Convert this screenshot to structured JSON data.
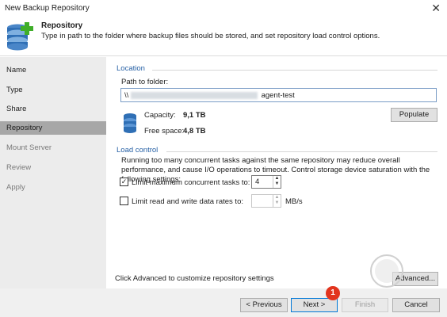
{
  "window": {
    "title": "New Backup Repository",
    "close_glyph": "✕"
  },
  "header": {
    "title": "Repository",
    "description": "Type in path to the folder where backup files should be stored, and set repository load control options.",
    "icon": "database-add-icon"
  },
  "sidebar": {
    "items": [
      {
        "label": "Name",
        "state": "normal"
      },
      {
        "label": "Type",
        "state": "normal"
      },
      {
        "label": "Share",
        "state": "normal"
      },
      {
        "label": "Repository",
        "state": "active"
      },
      {
        "label": "Mount Server",
        "state": "disabled"
      },
      {
        "label": "Review",
        "state": "disabled"
      },
      {
        "label": "Apply",
        "state": "disabled"
      }
    ]
  },
  "location": {
    "section_label": "Location",
    "path_label": "Path to folder:",
    "path_prefix": "\\\\",
    "path_suffix": "agent-test",
    "capacity_label": "Capacity:",
    "capacity_value": "9,1 TB",
    "free_label": "Free space:",
    "free_value": "4,8 TB",
    "populate_label": "Populate"
  },
  "load_control": {
    "section_label": "Load control",
    "description": "Running too many concurrent tasks against the same repository may reduce overall performance, and cause I/O operations to timeout. Control storage device saturation with the following settings:",
    "limit_tasks_label": "Limit maximum concurrent tasks to:",
    "limit_tasks_checked": true,
    "tasks_value": "4",
    "limit_rate_label": "Limit read and write data rates to:",
    "limit_rate_checked": false,
    "rate_value": "",
    "rate_unit": "MB/s"
  },
  "advanced": {
    "hint": "Click Advanced to customize repository settings",
    "button_label": "Advanced..."
  },
  "footer": {
    "previous": "< Previous",
    "next": "Next >",
    "finish": "Finish",
    "cancel": "Cancel",
    "badge": "1"
  },
  "colors": {
    "accent": "#2660a5",
    "active_nav": "#a7a7a7",
    "badge": "#e2341d",
    "plus_green": "#3fae29"
  }
}
